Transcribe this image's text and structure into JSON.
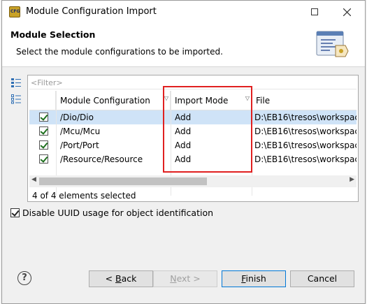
{
  "window": {
    "title": "Module Configuration Import",
    "app_icon_text": "CFG",
    "controls": {
      "minimize": "—",
      "maximize": "☐",
      "close": "✕"
    }
  },
  "header": {
    "title": "Module Selection",
    "description": "Select the module configurations to be imported."
  },
  "filter": {
    "placeholder": "<Filter>"
  },
  "table": {
    "columns": [
      "Module Configuration",
      "Import Mode",
      "File"
    ],
    "rows": [
      {
        "checked": true,
        "module": "/Dio/Dio",
        "mode": "Add",
        "file": "D:\\EB16\\tresos\\workspac"
      },
      {
        "checked": true,
        "module": "/Mcu/Mcu",
        "mode": "Add",
        "file": "D:\\EB16\\tresos\\workspac"
      },
      {
        "checked": true,
        "module": "/Port/Port",
        "mode": "Add",
        "file": "D:\\EB16\\tresos\\workspac"
      },
      {
        "checked": true,
        "module": "/Resource/Resource",
        "mode": "Add",
        "file": "D:\\EB16\\tresos\\workspac"
      }
    ],
    "status": "4 of 4 elements selected"
  },
  "options": {
    "disable_uuid": {
      "checked": true,
      "label": "Disable UUID usage for object identification"
    }
  },
  "buttons": {
    "help": "?",
    "back": {
      "pre": "< ",
      "mn": "B",
      "post": "ack"
    },
    "next": {
      "pre": "",
      "mn": "N",
      "post": "ext >"
    },
    "finish": {
      "pre": "",
      "mn": "F",
      "post": "inish"
    },
    "cancel": "Cancel"
  },
  "colors": {
    "highlight_box": "#e02020",
    "selection_row": "#cfe3f7",
    "checkmark": "#1c6e1c"
  }
}
